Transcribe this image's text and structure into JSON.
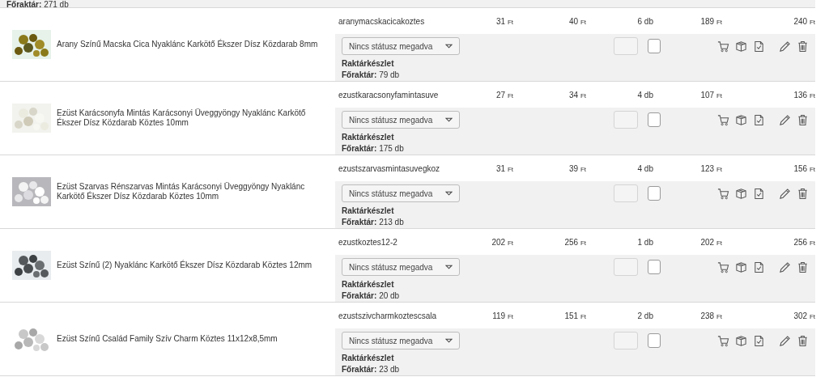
{
  "partial_row": {
    "stock_line": "**Főraktár:** 271 db"
  },
  "rows": [
    {
      "name": "Arany Színű Macska Cica Nyaklánc Karkötő Ékszer Dísz Közdarab 8mm",
      "sku": "aranymacskacicakoztes",
      "unit_price_net": "31 Ft",
      "unit_price_gross": "40 Ft",
      "quantity": "6 db",
      "total_net": "189 Ft",
      "total_gross": "240 Ft",
      "status": "Nincs státusz megadva",
      "checked": false,
      "stock_title": "Raktárkészlet",
      "stock_line": "**Főraktár:** 79 db"
    },
    {
      "name": "Ezüst Karácsonyfa Mintás Karácsonyi Üveggyöngy Nyaklánc Karkötő Ékszer Dísz Közdarab Köztes 10mm",
      "sku": "ezustkaracsonyfamintasuve",
      "unit_price_net": "27 Ft",
      "unit_price_gross": "34 Ft",
      "quantity": "4 db",
      "total_net": "107 Ft",
      "total_gross": "136 Ft",
      "status": "Nincs státusz megadva",
      "checked": false,
      "stock_title": "Raktárkészlet",
      "stock_line": "**Főraktár:** 175 db"
    },
    {
      "name": "Ezüst Szarvas Rénszarvas Mintás Karácsonyi Üveggyöngy Nyaklánc Karkötő Ékszer Dísz Közdarab Köztes 10mm",
      "sku": "ezustszarvasmintasuvegkoz",
      "unit_price_net": "31 Ft",
      "unit_price_gross": "39 Ft",
      "quantity": "4 db",
      "total_net": "123 Ft",
      "total_gross": "156 Ft",
      "status": "Nincs státusz megadva",
      "checked": false,
      "stock_title": "Raktárkészlet",
      "stock_line": "**Főraktár:** 213 db"
    },
    {
      "name": "Ezüst Színű (2) Nyaklánc Karkötő Ékszer Dísz Közdarab Köztes 12mm",
      "sku": "ezustkoztes12-2",
      "unit_price_net": "202 Ft",
      "unit_price_gross": "256 Ft",
      "quantity": "1 db",
      "total_net": "202 Ft",
      "total_gross": "256 Ft",
      "status": "Nincs státusz megadva",
      "checked": false,
      "stock_title": "Raktárkészlet",
      "stock_line": "**Főraktár:** 20 db"
    },
    {
      "name": "Ezüst Színű Család Family Szív Charm Köztes 11x12x8,5mm",
      "sku": "ezustszivcharmkoztescsala",
      "unit_price_net": "119 Ft",
      "unit_price_gross": "151 Ft",
      "quantity": "2 db",
      "total_net": "238 Ft",
      "total_gross": "302 Ft",
      "status": "Nincs státusz megadva",
      "checked": false,
      "stock_title": "Raktárkészlet",
      "stock_line": "**Főraktár:** 23 db"
    }
  ]
}
